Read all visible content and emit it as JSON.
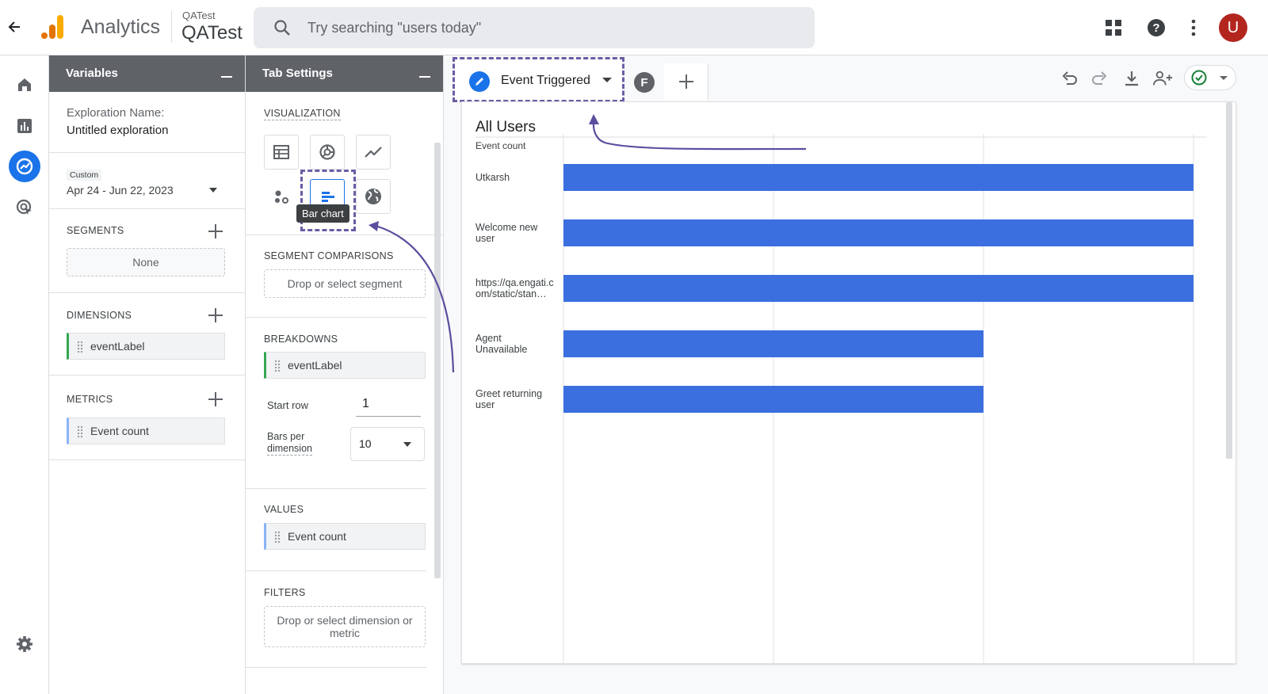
{
  "topbar": {
    "app_name": "Analytics",
    "account_small": "QATest",
    "account_big": "QATest",
    "search_placeholder": "Try searching \"users today\"",
    "avatar_letter": "U"
  },
  "variables": {
    "title": "Variables",
    "exploration_label": "Exploration Name:",
    "exploration_name": "Untitled exploration",
    "date_tag": "Custom",
    "date_range": "Apr 24 - Jun 22, 2023",
    "segments_title": "SEGMENTS",
    "segments_none": "None",
    "dimensions_title": "DIMENSIONS",
    "dimensions": [
      "eventLabel"
    ],
    "metrics_title": "METRICS",
    "metrics": [
      "Event count"
    ]
  },
  "tab_settings": {
    "title": "Tab Settings",
    "visualization_title": "VISUALIZATION",
    "tooltip": "Bar chart",
    "segment_comparisons_title": "SEGMENT COMPARISONS",
    "segment_drop": "Drop or select segment",
    "breakdowns_title": "BREAKDOWNS",
    "breakdown": "eventLabel",
    "start_row_label": "Start row",
    "start_row_value": "1",
    "bars_per_dim_label_1": "Bars per",
    "bars_per_dim_label_2": "dimension",
    "bars_per_dim_value": "10",
    "values_title": "VALUES",
    "value": "Event count",
    "filters_title": "FILTERS",
    "filters_drop": "Drop or select dimension or metric"
  },
  "canvas": {
    "tab_label": "Event Triggered",
    "tab_f": "F"
  },
  "chart_data": {
    "type": "bar",
    "orientation": "horizontal",
    "title": "All Users",
    "metric_label": "Event count",
    "categories": [
      "Utkarsh",
      "Welcome new user",
      "https://qa.engati.com/static/stan…",
      "Agent Unavailable",
      "Greet returning user"
    ],
    "category_lines": [
      [
        "Utkarsh"
      ],
      [
        "Welcome new",
        "user"
      ],
      [
        "https://qa.engati.c",
        "om/static/stan…"
      ],
      [
        "Agent",
        "Unavailable"
      ],
      [
        "Greet returning",
        "user"
      ]
    ],
    "values": [
      3,
      3,
      3,
      2,
      2
    ],
    "xlim": [
      0,
      3
    ],
    "grid": true,
    "color": "#3b6fe0"
  }
}
